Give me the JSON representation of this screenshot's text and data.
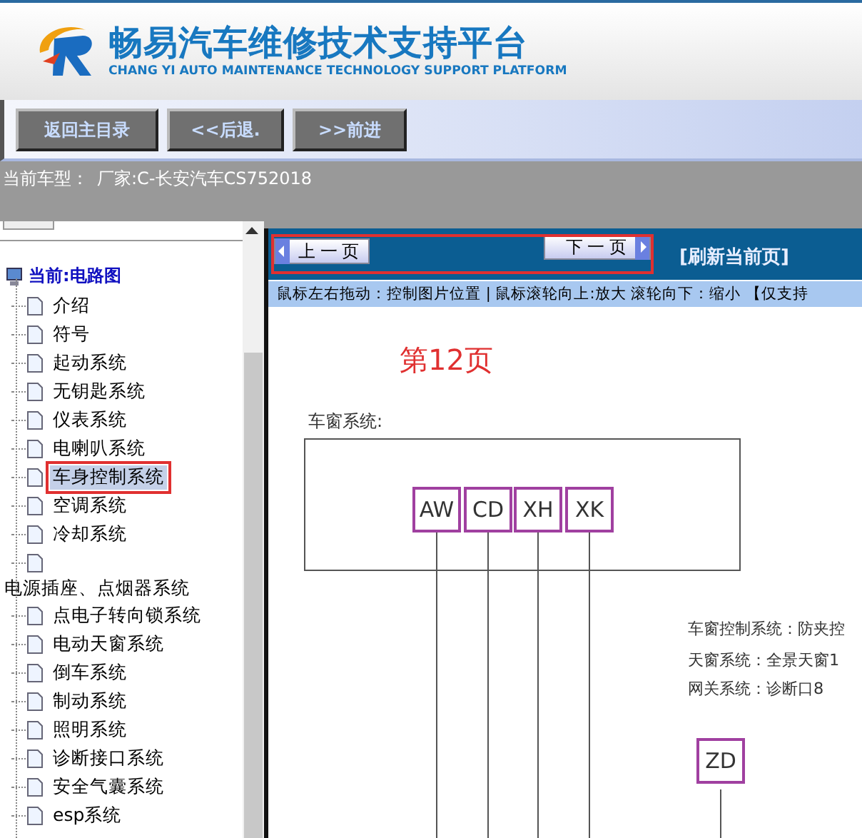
{
  "header": {
    "title": "畅易汽车维修技术支持平台",
    "subtitle": "CHANG YI AUTO MAINTENANCE TECHNOLOGY SUPPORT PLATFORM"
  },
  "toolbar": {
    "buttons": [
      "返回主目录",
      "<<后退.",
      ">>前进"
    ]
  },
  "vehicle": {
    "label": "当前车型：",
    "value": "厂家:C-长安汽车CS752018"
  },
  "tree": {
    "root": "当前:电路图",
    "children": [
      {
        "label": "介绍",
        "selected": false,
        "outlined": false
      },
      {
        "label": "符号",
        "selected": false,
        "outlined": false
      },
      {
        "label": "起动系统",
        "selected": false,
        "outlined": false
      },
      {
        "label": "无钥匙系统",
        "selected": false,
        "outlined": false
      },
      {
        "label": "仪表系统",
        "selected": false,
        "outlined": false
      },
      {
        "label": "电喇叭系统",
        "selected": false,
        "outlined": false
      },
      {
        "label": "车身控制系统",
        "selected": true,
        "outlined": true
      },
      {
        "label": "空调系统",
        "selected": false,
        "outlined": false
      },
      {
        "label": "冷却系统",
        "selected": false,
        "outlined": false
      },
      {
        "label": "电源插座、点烟器系统",
        "selected": false,
        "outlined": false,
        "kind": "wrapped"
      },
      {
        "label": "点电子转向锁系统",
        "selected": false,
        "outlined": false
      },
      {
        "label": "电动天窗系统",
        "selected": false,
        "outlined": false
      },
      {
        "label": "倒车系统",
        "selected": false,
        "outlined": false
      },
      {
        "label": "制动系统",
        "selected": false,
        "outlined": false
      },
      {
        "label": "照明系统",
        "selected": false,
        "outlined": false
      },
      {
        "label": "诊断接口系统",
        "selected": false,
        "outlined": false
      },
      {
        "label": "安全气囊系统",
        "selected": false,
        "outlined": false
      },
      {
        "label": "esp系统",
        "selected": false,
        "outlined": false
      }
    ]
  },
  "viewer": {
    "prev": "上一页",
    "next": "下一页",
    "outlined": true,
    "refresh": "[刷新当前页]",
    "hint": "鼠标左右拖动：控制图片位置 | 鼠标滚轮向上:放大  滚轮向下：缩小 【仅支持",
    "page": "第12页",
    "diagram": {
      "heading": "车窗系统:",
      "connectors": [
        "AW",
        "CD",
        "XH",
        "XK"
      ],
      "notes": [
        "车窗控制系统：防夹控",
        "天窗系统：全景天窗1",
        "网关系统：诊断口8"
      ],
      "module": "ZD"
    }
  }
}
